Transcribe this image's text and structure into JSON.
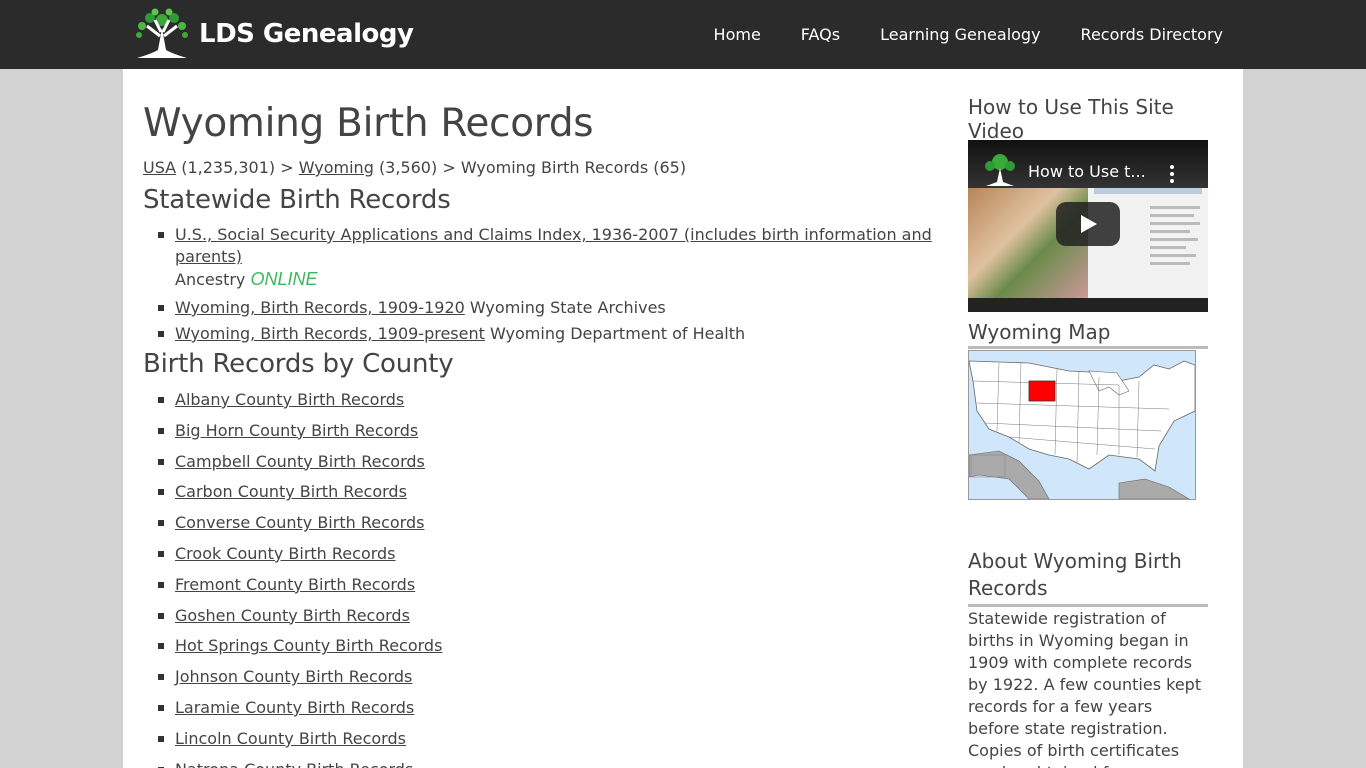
{
  "site": {
    "logo_text": "LDS Genealogy",
    "nav": [
      "Home",
      "FAQs",
      "Learning Genealogy",
      "Records Directory"
    ]
  },
  "page": {
    "title": "Wyoming Birth Records",
    "breadcrumb": {
      "usa": "USA",
      "usa_count": "(1,235,301)",
      "sep1": ">",
      "wyoming": "Wyoming",
      "wyoming_count": "(3,560)",
      "sep2": ">",
      "current": "Wyoming Birth Records (65)"
    },
    "statewide_heading": "Statewide Birth Records",
    "statewide": [
      {
        "link": "U.S., Social Security Applications and Claims Index, 1936-2007 (includes birth information and parents)",
        "source": "Ancestry",
        "badge": "ONLINE"
      },
      {
        "link": "Wyoming, Birth Records, 1909-1920",
        "source": "Wyoming State Archives"
      },
      {
        "link": "Wyoming, Birth Records, 1909-present",
        "source": "Wyoming Department of Health"
      }
    ],
    "county_heading": "Birth Records by County",
    "counties": [
      "Albany County Birth Records",
      "Big Horn County Birth Records",
      "Campbell County Birth Records",
      "Carbon County Birth Records",
      "Converse County Birth Records",
      "Crook County Birth Records",
      "Fremont County Birth Records",
      "Goshen County Birth Records",
      "Hot Springs County Birth Records",
      "Johnson County Birth Records",
      "Laramie County Birth Records",
      "Lincoln County Birth Records",
      "Natrona County Birth Records"
    ]
  },
  "sidebar": {
    "video_heading": "How to Use This Site Video",
    "video_title": "How to Use t...",
    "map_heading": "Wyoming Map",
    "about_heading": "About Wyoming Birth Records",
    "about_text": "Statewide registration of births in Wyoming began in 1909 with complete records by 1922. A few counties kept records for a few years before state registration. Copies of birth certificates can be obtained from Wyoming Vital Records"
  },
  "colors": {
    "topbar": "#2b2b2b",
    "background": "#d2d2d2",
    "online_badge": "#3cb85a",
    "map_highlight": "#ff0000"
  }
}
